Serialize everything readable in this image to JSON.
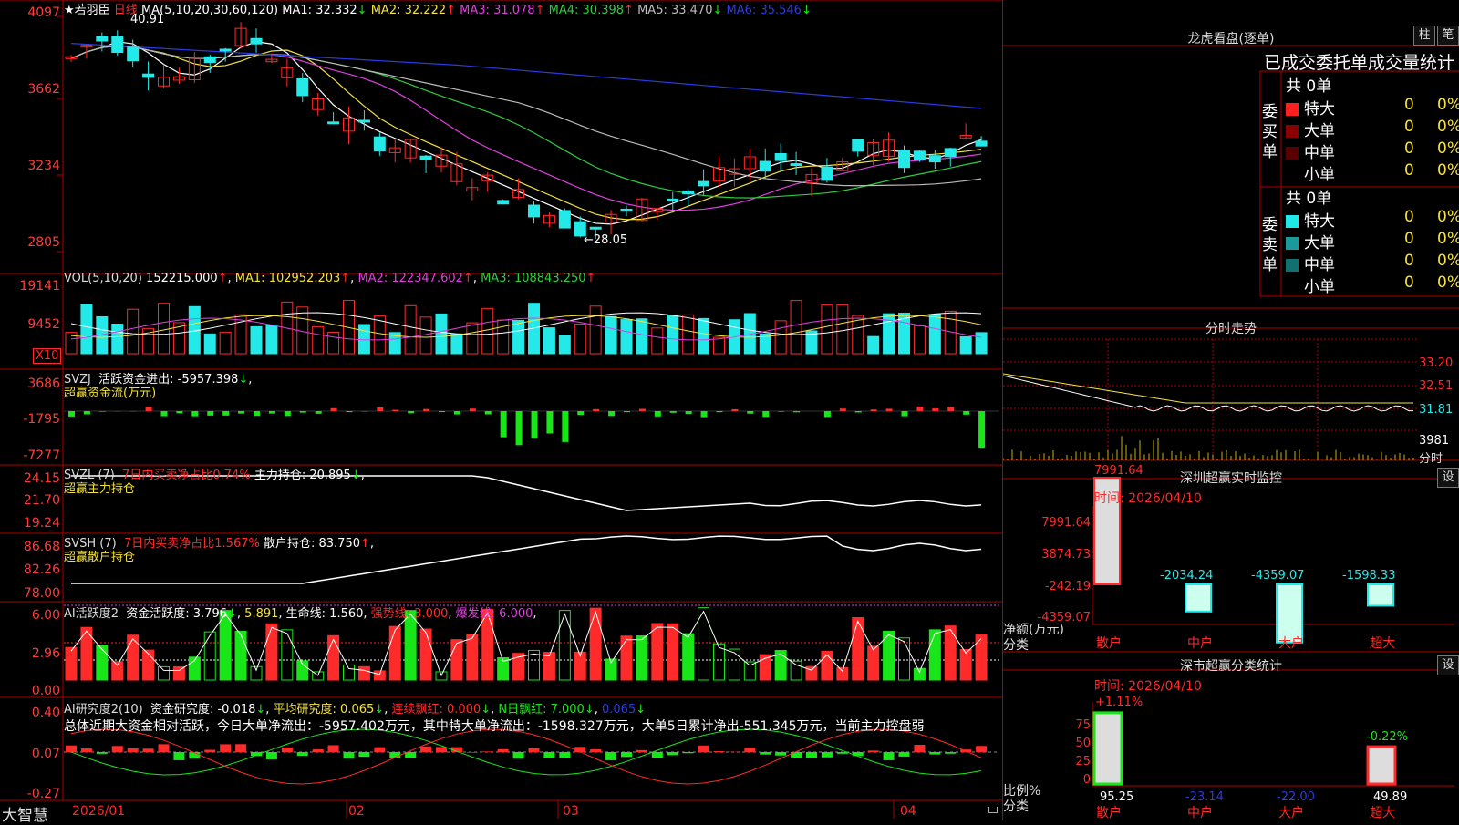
{
  "colors": {
    "up": "#ff2a2a",
    "down": "#24e9e9",
    "green": "#19e619",
    "ma1": "#ffffff",
    "ma2": "#f5e23c",
    "ma3": "#e040e0",
    "ma4": "#2ecc40",
    "ma5": "#bbbbbb",
    "ma6": "#2b3bdc",
    "grid": "#b00000"
  },
  "main": {
    "stock_name": "★若羽臣",
    "period": "日线",
    "ma_params": "MA(5,10,20,30,60,120)",
    "ma_values": [
      {
        "label": "MA1:",
        "value": "32.332",
        "arrow": "↓"
      },
      {
        "label": "MA2:",
        "value": "32.222",
        "arrow": "↑"
      },
      {
        "label": "MA3:",
        "value": "31.078",
        "arrow": "↑"
      },
      {
        "label": "MA4:",
        "value": "30.398",
        "arrow": "↑"
      },
      {
        "label": "MA5:",
        "value": "33.470",
        "arrow": "↓"
      },
      {
        "label": "MA6:",
        "value": "35.546",
        "arrow": "↓"
      }
    ],
    "y_ticks": [
      "4097",
      "3662",
      "3234",
      "2805"
    ],
    "high_label": "40.91",
    "low_label": "←28.05"
  },
  "vol": {
    "title": "VOL(5,10,20)",
    "value": "152215.000",
    "arrow": "↑",
    "ma1": "MA1: 102952.203",
    "ma1_arrow": "↑",
    "ma2": "MA2: 122347.602",
    "ma2_arrow": "↑",
    "ma3": "MA3: 108843.250",
    "ma3_arrow": "↑",
    "y_ticks": [
      "19141",
      "9452"
    ],
    "unit": "X10"
  },
  "svzj": {
    "title": "SVZJ",
    "sub": "活跃资金进出: -5957.398",
    "arrow": "↓",
    "label2": "超赢资金流(万元)",
    "y_ticks": [
      "3686",
      "-1795",
      "-7277"
    ]
  },
  "svzl": {
    "title": "SVZL (7)",
    "sub": "7日内买卖净占比0.74%",
    "sub2": "主力持仓: 20.895",
    "arrow": "↓",
    "label2": "超赢主力持仓",
    "y_ticks": [
      "24.15",
      "21.70",
      "19.24"
    ]
  },
  "svsh": {
    "title": "SVSH (7)",
    "sub": "7日内买卖净占比1.567%",
    "sub2": "散户持仓: 83.750",
    "arrow": "↑",
    "label2": "超赢散户持仓",
    "y_ticks": [
      "86.68",
      "82.26",
      "78.00"
    ]
  },
  "ai1": {
    "title": "AI活跃度2",
    "label": "资金活跃度: 3.796",
    "arrow": "↓",
    "v2": "5.891",
    "life": "生命线: 1.560",
    "strong": "强势线: 3.000",
    "burst": "爆发线: 6.000",
    "y_ticks": [
      "6.00",
      "2.96",
      "0.00"
    ]
  },
  "ai2": {
    "title": "AI研究度2(10)",
    "label": "资金研究度: -0.018",
    "arrow": "↓",
    "avg": "平均研究度: 0.065",
    "cont": "连续飘红: 0.000",
    "nday": "N日飘红: 7.000",
    "last": "0.065",
    "y_ticks": [
      "0.40",
      "0.07",
      "-0.27"
    ],
    "summary": "总体近期大资金相对活跃，今日大单净流出：-5957.402万元，其中特大单净流出：-1598.327万元，大单5日累计净出-551.345万元，当前主力控盘弱"
  },
  "x_axis": [
    "2026/01",
    "02",
    "03",
    "04"
  ],
  "footer_logo": "大智慧",
  "right": {
    "lhb_title": "龙虎看盘(逐单)",
    "btn_zhu": "柱",
    "btn_bi": "笔",
    "stat_header": "已成交委托单成交量统计",
    "buy": {
      "side": "委买单",
      "total": "共 0单",
      "rows": [
        {
          "label": "特大",
          "n": "0",
          "p": "0%"
        },
        {
          "label": "大单",
          "n": "0",
          "p": "0%"
        },
        {
          "label": "中单",
          "n": "0",
          "p": "0%"
        },
        {
          "label": "小单",
          "n": "0",
          "p": "0%"
        }
      ]
    },
    "sell": {
      "side": "委卖单",
      "total": "共 0单",
      "rows": [
        {
          "label": "特大",
          "n": "0",
          "p": "0%"
        },
        {
          "label": "大单",
          "n": "0",
          "p": "0%"
        },
        {
          "label": "中单",
          "n": "0",
          "p": "0%"
        },
        {
          "label": "小单",
          "n": "0",
          "p": "0%"
        }
      ]
    },
    "intraday": {
      "title": "分时走势",
      "y_ticks": [
        "33.20",
        "32.51",
        "31.81"
      ],
      "vol_tick": "3981",
      "unit": "分时"
    },
    "sz_monitor": {
      "title": "深圳超赢实时监控",
      "btn": "设",
      "time": "时间: 2026/04/10",
      "ylab": "净额(万元)",
      "xlab": "分类",
      "y_ticks": [
        "7991.64",
        "3874.73",
        "-242.19",
        "-4359.07"
      ],
      "cats": [
        "散户",
        "中户",
        "大户",
        "超大"
      ],
      "values": [
        7991.64,
        -2034.24,
        -4359.07,
        -1598.33
      ],
      "labels": [
        "7991.64",
        "-2034.24",
        "-4359.07",
        "-1598.33"
      ]
    },
    "sz_class": {
      "title": "深市超赢分类统计",
      "btn": "设",
      "time": "时间: 2026/04/10",
      "ylab": "比例%",
      "xlab": "分类",
      "y_ticks": [
        "75",
        "50",
        "25",
        "0"
      ],
      "top_labels": [
        "+1.11%",
        "-0.22%"
      ],
      "cats": [
        "散户",
        "中户",
        "大户",
        "超大"
      ],
      "values": [
        95.25,
        -23.14,
        -22.0,
        49.89
      ],
      "labels": [
        "95.25",
        "-23.14",
        "-22.00",
        "49.89"
      ]
    }
  }
}
